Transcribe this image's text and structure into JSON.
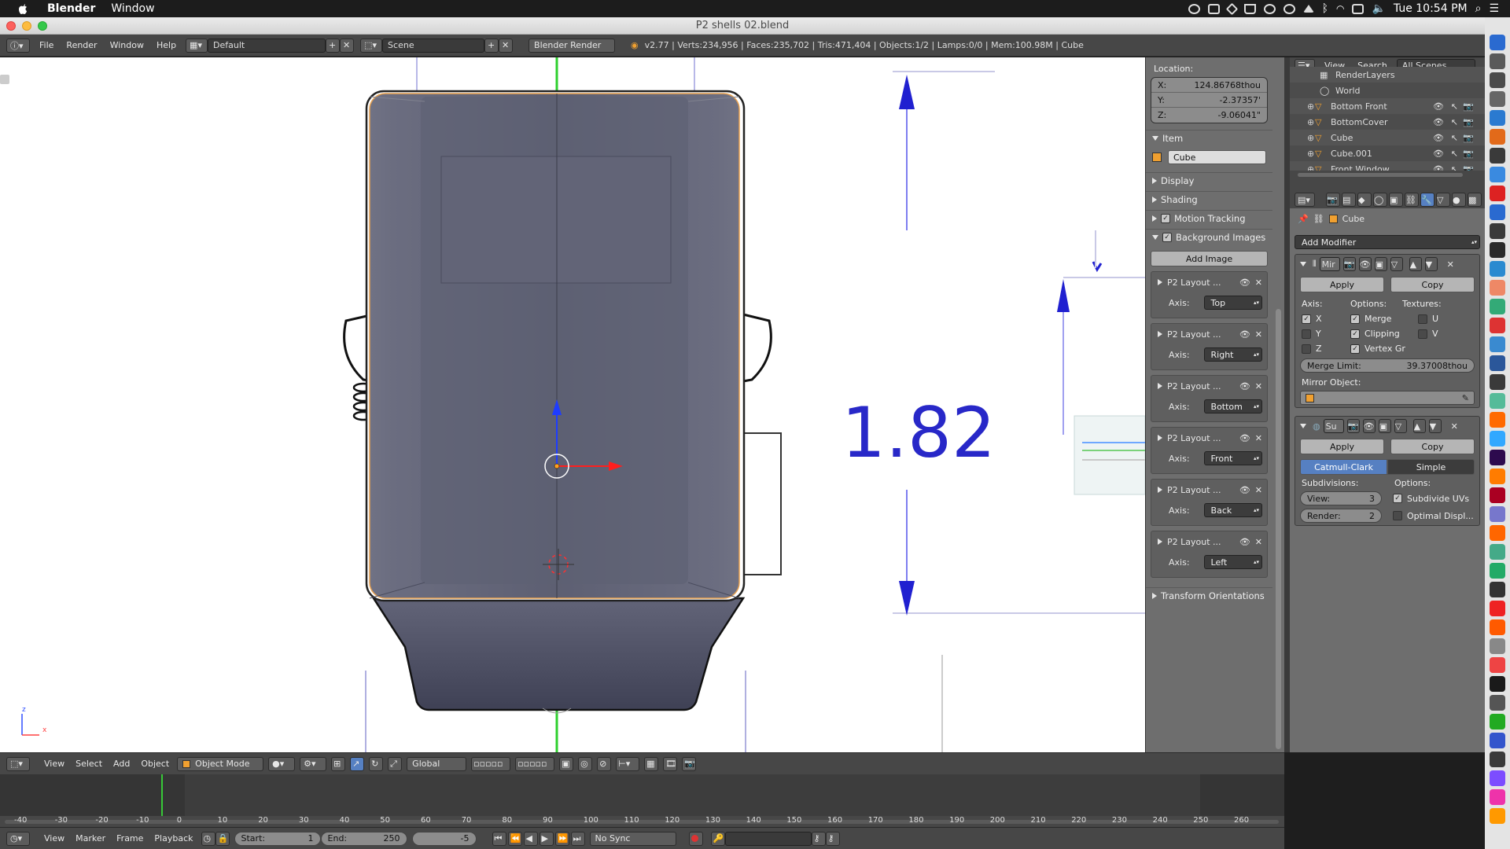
{
  "mac_menubar": {
    "app": "Blender",
    "menu": "Window",
    "clock": "Tue 10:54 PM"
  },
  "window": {
    "title": "P2 shells 02.blend"
  },
  "info_header": {
    "menus": [
      "File",
      "Render",
      "Window",
      "Help"
    ],
    "layout": "Default",
    "scene": "Scene",
    "engine": "Blender Render",
    "stats": "v2.77 | Verts:234,956 | Faces:235,702 | Tris:471,404 | Objects:1/2 | Lamps:0/0 | Mem:100.98M | Cube"
  },
  "viewport": {
    "dimension_label": "1.82",
    "axis_z": "z",
    "axis_x": "x"
  },
  "npanel": {
    "location_label": "Location:",
    "loc_x_label": "X:",
    "loc_x": "124.86768thou",
    "loc_y_label": "Y:",
    "loc_y": "-2.37357'",
    "loc_z_label": "Z:",
    "loc_z": "-9.06041\"",
    "item_section": "Item",
    "item_name": "Cube",
    "display_section": "Display",
    "shading_section": "Shading",
    "motion_section": "Motion Tracking",
    "bg_section": "Background Images",
    "add_image": "Add Image",
    "axis_label": "Axis:",
    "bg_images": [
      {
        "name": "P2 Layout ...",
        "axis": "Top"
      },
      {
        "name": "P2 Layout ...",
        "axis": "Right"
      },
      {
        "name": "P2 Layout ...",
        "axis": "Bottom"
      },
      {
        "name": "P2 Layout ...",
        "axis": "Front"
      },
      {
        "name": "P2 Layout ...",
        "axis": "Back"
      },
      {
        "name": "P2 Layout ...",
        "axis": "Left"
      }
    ],
    "transform_orient": "Transform Orientations"
  },
  "outliner": {
    "menus": [
      "View",
      "Search"
    ],
    "filter": "All Scenes",
    "items": [
      "RenderLayers",
      "World",
      "Bottom Front",
      "BottomCover",
      "Cube",
      "Cube.001",
      "Front Window"
    ]
  },
  "properties": {
    "object": "Cube",
    "add_modifier": "Add Modifier",
    "mirror": {
      "name": "Mir",
      "apply": "Apply",
      "copy": "Copy",
      "axis_label": "Axis:",
      "options_label": "Options:",
      "textures_label": "Textures:",
      "x": "X",
      "y": "Y",
      "z": "Z",
      "merge": "Merge",
      "clipping": "Clipping",
      "vertex": "Vertex Gr",
      "u": "U",
      "v": "V",
      "merge_limit_label": "Merge Limit:",
      "merge_limit": "39.37008thou",
      "mirror_object": "Mirror Object:"
    },
    "subsurf": {
      "name": "Su",
      "apply": "Apply",
      "copy": "Copy",
      "catmull": "Catmull-Clark",
      "simple": "Simple",
      "subdiv_label": "Subdivisions:",
      "options_label": "Options:",
      "view_label": "View:",
      "view": "3",
      "render_label": "Render:",
      "render": "2",
      "subdivide_uvs": "Subdivide UVs",
      "optimal": "Optimal Displ..."
    }
  },
  "viewport_header": {
    "menus": [
      "View",
      "Select",
      "Add",
      "Object"
    ],
    "mode": "Object Mode",
    "orientation": "Global"
  },
  "timeline": {
    "ticks": [
      "-40",
      "-30",
      "-20",
      "-10",
      "0",
      "10",
      "20",
      "30",
      "40",
      "50",
      "60",
      "70",
      "80",
      "90",
      "100",
      "110",
      "120",
      "130",
      "140",
      "150",
      "160",
      "170",
      "180",
      "190",
      "200",
      "210",
      "220",
      "230",
      "240",
      "250",
      "260"
    ],
    "menus": [
      "View",
      "Marker",
      "Frame",
      "Playback"
    ],
    "start_label": "Start:",
    "start": "1",
    "end_label": "End:",
    "end": "250",
    "current": "-5",
    "sync": "No Sync"
  }
}
